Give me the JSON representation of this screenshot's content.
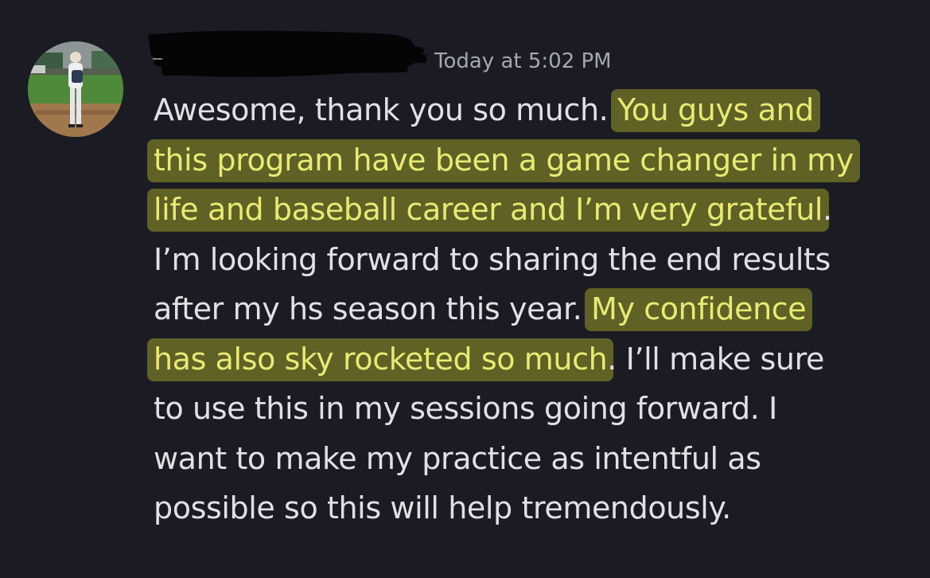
{
  "message": {
    "timestamp": "Today at 5:02 PM",
    "lines": [
      [
        {
          "text": "Awesome, thank you so much. ",
          "highlight": false
        },
        {
          "text": "You guys and",
          "highlight": true
        }
      ],
      [
        {
          "text": "this program have been a game changer in my",
          "highlight": true
        }
      ],
      [
        {
          "text": "life and baseball career and I’m very grateful",
          "highlight": true
        },
        {
          "text": ".",
          "highlight": false
        }
      ],
      [
        {
          "text": "I’m looking forward to sharing the end results",
          "highlight": false
        }
      ],
      [
        {
          "text": "after my hs season this year. ",
          "highlight": false
        },
        {
          "text": "My confidence",
          "highlight": true
        }
      ],
      [
        {
          "text": "has also sky rocketed so much",
          "highlight": true
        },
        {
          "text": ". I’ll make sure",
          "highlight": false
        }
      ],
      [
        {
          "text": "to use this in my sessions going forward. I",
          "highlight": false
        }
      ],
      [
        {
          "text": "want to make my practice as intentful as",
          "highlight": false
        }
      ],
      [
        {
          "text": "possible so this will help tremendously.",
          "highlight": false
        }
      ]
    ]
  },
  "colors": {
    "background": "#1b1c23",
    "text": "#dfe1e5",
    "timestamp": "#a5a8ae",
    "highlight": "#c6cb28",
    "highlight_text": "#e9ea74"
  },
  "icons": {
    "avatar": "user-avatar-photo",
    "redaction": "redacted-username"
  }
}
